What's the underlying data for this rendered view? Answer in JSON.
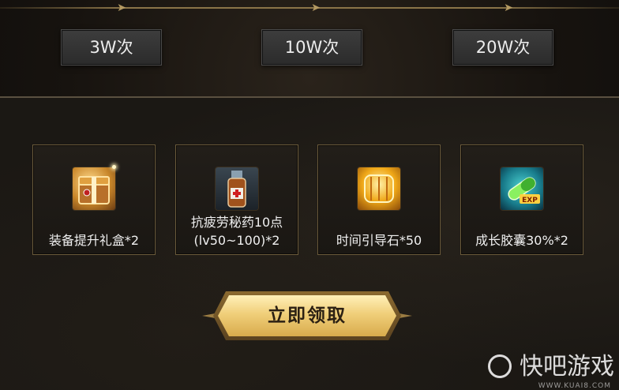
{
  "tiers": [
    {
      "label": "3W次"
    },
    {
      "label": "10W次"
    },
    {
      "label": "20W次"
    }
  ],
  "rewards": [
    {
      "name": "装备提升礼盒*2",
      "icon": "gift-box-icon"
    },
    {
      "name_line1": "抗疲劳秘药10点",
      "name_line2": "(lv50~100)*2",
      "icon": "potion-bottle-icon"
    },
    {
      "name": "时间引导石*50",
      "icon": "time-stone-icon"
    },
    {
      "name": "成长胶囊30%*2",
      "icon": "exp-capsule-icon"
    }
  ],
  "claim_button": {
    "label": "立即领取"
  },
  "watermark": {
    "text": "快吧游戏",
    "url": "WWW.KUAI8.COM"
  },
  "colors": {
    "accent_gold": "#f0cf7a",
    "card_border": "#6a5a3a",
    "button_gray": "#333333"
  }
}
